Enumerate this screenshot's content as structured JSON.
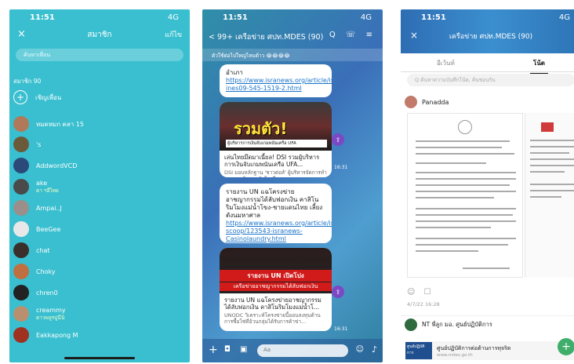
{
  "phone1": {
    "status": {
      "time": "11:51",
      "signal": "4G"
    },
    "header": {
      "close_icon": "×",
      "title": "สมาชิก",
      "edit": "แก้ไข"
    },
    "search_placeholder": "ค้นหาเพื่อน",
    "member_count": "สมาชิก 90",
    "invite_label": "เชิญเพื่อน",
    "members": [
      {
        "name": "หมดหมก ตลา 15",
        "sub": "",
        "color": "#b07a5a"
      },
      {
        "name": "'s",
        "sub": "",
        "color": "#6b5a3a"
      },
      {
        "name": "AddwordVCD",
        "sub": "",
        "color": "#2b4a7a"
      },
      {
        "name": "ake",
        "sub": "ตา ฯอีไทย",
        "color": "#4a4a4a"
      },
      {
        "name": "Ampai..J",
        "sub": "",
        "color": "#9a8f8a"
      },
      {
        "name": "BeeGee",
        "sub": "",
        "color": "#e8e8e8"
      },
      {
        "name": "chat",
        "sub": "",
        "color": "#3a2f2a"
      },
      {
        "name": "Choky",
        "sub": "",
        "color": "#c07040"
      },
      {
        "name": "chren0",
        "sub": "",
        "color": "#222222"
      },
      {
        "name": "creammy",
        "sub": "ดาวพลูรบู่นี่นิ",
        "color": "#b89070"
      },
      {
        "name": "Eakkapong M",
        "sub": "",
        "color": "#a03020"
      }
    ]
  },
  "phone2": {
    "status": {
      "time": "11:51",
      "signal": "4G"
    },
    "header": {
      "back": "< 99+ เครือข่าย ศปท.MDES (90)",
      "icons": "Q ☏ ≡"
    },
    "announcement": "ตัวใช้ต่อไปใหญ่ไหมด้าว 😂😂😂😂",
    "msg1": {
      "text": "อำเภา ",
      "link": "https://www.isranews.org/article/isranews/123571-ines09-545-1519-2.html"
    },
    "card1": {
      "headline": "รวมตัว!",
      "caption": "ผู้บริหารการเงินจับเกมพนันเครือ UFA",
      "title": "เล่นไทยมึดมาเนี้ยล! DSI รวมผู้บริหารการเงินจับเกมพนันเครือ UFA...",
      "desc": "DSI มอบหลักฐาน 'ชาวต่อส์' ผู้บริหารจัดการทำรายการเงินและจับไท คีม...",
      "time": "16:31"
    },
    "msg2": {
      "text": "รายงาน UN แฉโครงข่ายอาชญากรรมได้ลับฟอกเงิน คาสิโนริมโมงแม่น้ำโขง-ชายแดนไทย เลี้ยงตังนมหาศาล ",
      "link": "https://www.isranews.org/article/isranews-scoop/123543-isranews-Casinolaundry.html"
    },
    "card2": {
      "bar1": "รายงาน UN เปิดโปง",
      "bar2": "เครือข่ายอาชญากรรมได้ลับฟอกเงิน",
      "title": "รายงาน UN แฉโครงข่ายอาชญากรรมได้ลับฟอกเงิน คาสิโนริมโมงแม่น้ำโ...",
      "desc": "UNODC วิเคราะห์โครงข่ายนี้ออนลงทุนด้านการซื้อโซ่ที่อ้วนกลุ่มได้รับการค้าข่า...",
      "time": "16:31"
    },
    "input": {
      "placeholder": "Aa"
    }
  },
  "phone3": {
    "status": {
      "time": "11:51",
      "signal": "4G"
    },
    "header": {
      "close_icon": "×",
      "title": "เครือข่าย ศปท.MDES (90)"
    },
    "tabs": [
      "อีเว้นท์",
      "โน้ต"
    ],
    "search_placeholder": "Q ค้นหาความบันทึกโน้ต, ค้นชอบกัน",
    "post1": {
      "author": "Panadda",
      "reactions": "☺ ☐",
      "date": "4/7/22 16:28"
    },
    "post2": {
      "author": "NT พี่ลูก มอ. ศูนย์ปฏิบัติการ",
      "link_title": "ศูนย์ปฏิบัติการต่อต้านการทุจริต",
      "link_url": "www.mdes.go.th",
      "thumb_label": "ศูนย์ปฏิบัติการ"
    },
    "fab": "+"
  }
}
